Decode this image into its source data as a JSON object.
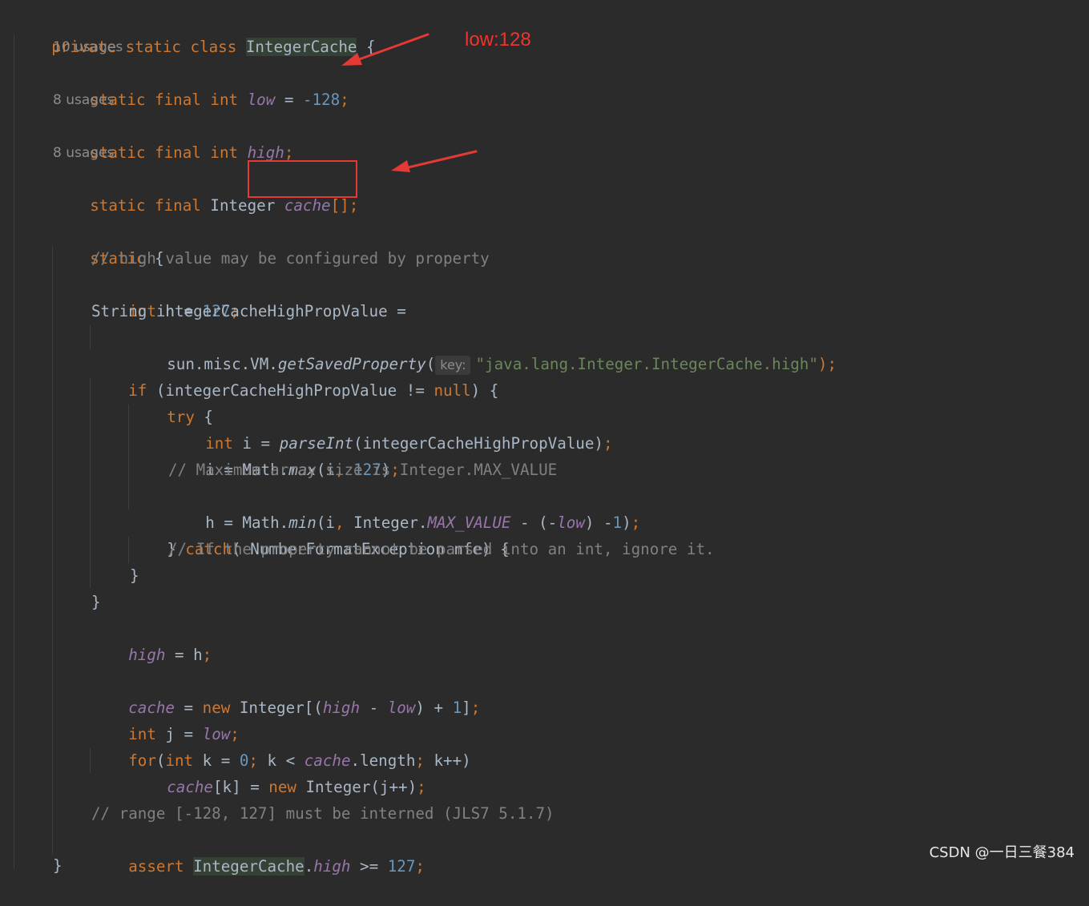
{
  "editor": {
    "class_decl": {
      "kw1": "private",
      "kw2": "static",
      "kw3": "class",
      "name": "IntegerCache",
      "brace": " {"
    },
    "usages": [
      "10 usages",
      "8 usages",
      "8 usages"
    ],
    "fields": {
      "low": {
        "kw": "static final int ",
        "name": "low",
        "rest1": " = ",
        "value": "-128",
        "semi": ";"
      },
      "high": {
        "kw": "static final int ",
        "name": "high",
        "semi": ";"
      },
      "cache": {
        "kw": "static final ",
        "type": "Integer ",
        "name": "cache",
        "rest": "[];"
      }
    },
    "static_block": {
      "open": "static",
      "brace": " {",
      "comment1": "// high value may be configured by property",
      "int_h": {
        "kw": "int",
        "rest": " h = ",
        "num": "127",
        "semi": ";"
      },
      "string_decl": "String integerCacheHighPropValue =",
      "getprop": {
        "prefix": "sun.misc.VM.",
        "method": "getSavedProperty",
        "paren": "(",
        "hint": "key:",
        "str": "\"java.lang.Integer.IntegerCache.high\"",
        "close": ");"
      },
      "if_line": {
        "kw": "if",
        "rest": " (integerCacheHighPropValue != ",
        "null": "null",
        "close": ") {"
      },
      "try_line": {
        "kw": "try",
        "rest": " {"
      },
      "int_i": {
        "kw": "int",
        "rest": " i = ",
        "method": "parseInt",
        "args": "(integerCacheHighPropValue)",
        "semi": ";"
      },
      "i_max": {
        "pre": "i = Math.",
        "method": "max",
        "args": "(i",
        "comma": ", ",
        "num": "127",
        "close": ")",
        "semi": ";"
      },
      "comment2": "// Maximum array size is Integer.MAX_VALUE",
      "h_min": {
        "pre": "h = Math.",
        "method": "min",
        "args": "(i",
        "comma": ", ",
        "mid": "Integer.",
        "const": "MAX_VALUE",
        "minus": " - (-",
        "low": "low",
        "close2": ") -",
        "num": "1",
        "close3": ")",
        "semi": ";"
      },
      "catch_line": {
        "pre": "} ",
        "kw": "catch",
        "rest": "( NumberFormatException nfe) {"
      },
      "comment3": "// If the property cannot be parsed into an int, ignore it.",
      "close_inner": "}",
      "close_if": "}",
      "high_assign": {
        "field": "high",
        "rest": " = h",
        "semi": ";"
      },
      "cache_assign": {
        "field": "cache",
        "eq": " = ",
        "kw": "new",
        "type": " Integer[(",
        "high": "high",
        "minus": " - ",
        "low": "low",
        "rest": ") + ",
        "num": "1",
        "close": "]",
        "semi": ";"
      },
      "int_j": {
        "kw": "int",
        "rest": " j = ",
        "low": "low",
        "semi": ";"
      },
      "for_line": {
        "kw": "for",
        "p1": "(",
        "kw2": "int",
        "rest": " k = ",
        "num": "0",
        "semi1": ";",
        "rest2": " k < ",
        "cache": "cache",
        "rest3": ".length",
        "semi2": ";",
        "rest4": " k++)"
      },
      "cache_k": {
        "cache": "cache",
        "rest": "[k] = ",
        "kw": "new",
        "rest2": " Integer(j++)",
        "semi": ";"
      },
      "comment4": "// range [-128, 127] must be interned (JLS7 5.1.7)",
      "assert_line": {
        "kw": "assert",
        "cls": "IntegerCache",
        "dot": ".",
        "high": "high",
        "rest": " >= ",
        "num": "127",
        "semi": ";"
      },
      "close_static": "}"
    }
  },
  "annotations": {
    "label": "low:128",
    "arrow_color": "#e53935"
  },
  "watermark": "CSDN @一日三餐384",
  "colors": {
    "background": "#2b2b2b",
    "keyword": "#cc7832",
    "string": "#6a8759",
    "number": "#6897bb",
    "comment": "#808080",
    "field": "#9876aa",
    "text": "#a9b7c6"
  }
}
